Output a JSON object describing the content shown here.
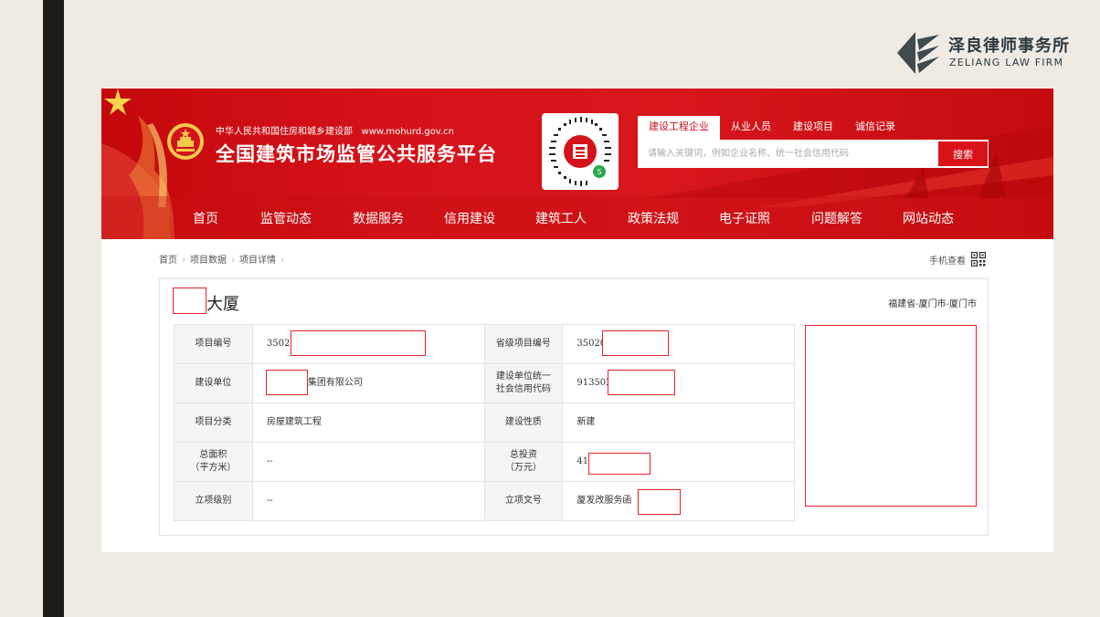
{
  "firm": {
    "name_cn": "泽良律师事务所",
    "name_en": "ZELIANG LAW FIRM"
  },
  "header": {
    "ministry": "中华人民共和国住房和城乡建设部",
    "website": "www.mohurd.gov.cn",
    "platform_title": "全国建筑市场监管公共服务平台"
  },
  "search": {
    "tabs": [
      {
        "label": "建设工程企业",
        "active": true
      },
      {
        "label": "从业人员",
        "active": false
      },
      {
        "label": "建设项目",
        "active": false
      },
      {
        "label": "诚信记录",
        "active": false
      }
    ],
    "placeholder": "请输入关键词，例如企业名称、统一社会信用代码",
    "button_label": "搜索"
  },
  "nav": [
    "首页",
    "监管动态",
    "数据服务",
    "信用建设",
    "建筑工人",
    "政策法规",
    "电子证照",
    "问题解答",
    "网站动态"
  ],
  "breadcrumb": [
    "首页",
    "项目数据",
    "项目详情"
  ],
  "mobile_view_label": "手机查看",
  "project": {
    "title": "大厦",
    "location": "福建省-厦门市-厦门市",
    "rows": [
      {
        "label1": "项目编号",
        "value1": "35020",
        "label2": "省级项目编号",
        "value2": "35020"
      },
      {
        "label1": "建设单位",
        "value1": "集团有限公司",
        "label2": "建设单位统一\n社会信用代码",
        "value2": "913502"
      },
      {
        "label1": "项目分类",
        "value1": "房屋建筑工程",
        "label2": "建设性质",
        "value2": "新建"
      },
      {
        "label1": "总面积\n（平方米）",
        "value1": "--",
        "label2": "总投资\n（万元）",
        "value2": "41"
      },
      {
        "label1": "立项级别",
        "value1": "--",
        "label2": "立项文号",
        "value2": "厦发改服务函"
      }
    ]
  },
  "colors": {
    "brand_red": "#d5121a",
    "redaction": "#e8232a",
    "firm_text": "#2d3a40"
  },
  "icons": [
    "firm-logo-icon",
    "national-emblem-icon",
    "mini-program-qr-icon",
    "qr-code-icon",
    "chevron-right-icon"
  ]
}
